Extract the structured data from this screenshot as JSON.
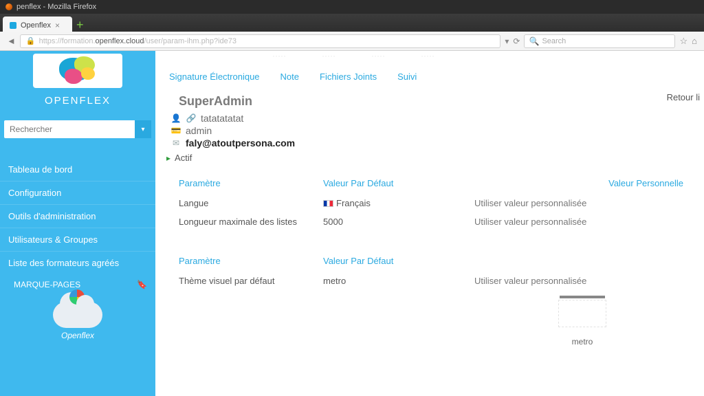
{
  "browser": {
    "window_title": "penflex - Mozilla Firefox",
    "tab_title": "Openflex",
    "url_faded_prefix": "https://formation.",
    "url_host": "openflex.cloud",
    "url_faded_suffix": "/user/param-ihm.php?ide73",
    "search_placeholder": "Search"
  },
  "sidebar": {
    "brand": "OPENFLEX",
    "search_placeholder": "Rechercher",
    "items": [
      "Tableau de bord",
      "Configuration",
      "Outils d'administration",
      "Utilisateurs & Groupes",
      "Liste des formateurs agréés"
    ],
    "bookmarks_label": "MARQUE-PAGES",
    "widget_name": "Openflex"
  },
  "subtabs": {
    "signature": "Signature Électronique",
    "note": "Note",
    "files": "Fichiers Joints",
    "tracking": "Suivi"
  },
  "back_link": "Retour li",
  "user": {
    "title": "SuperAdmin",
    "name_label": "tatatatatat",
    "login": "admin",
    "email": "faly@atoutpersona.com",
    "status": "Actif"
  },
  "params_section1": {
    "header_param": "Paramètre",
    "header_default": "Valeur Par Défaut",
    "header_personal": "Valeur Personnelle",
    "rows": [
      {
        "param": "Langue",
        "default": "Français",
        "personal": "Utiliser valeur personnalisée"
      },
      {
        "param": "Longueur maximale des listes",
        "default": "5000",
        "personal": "Utiliser valeur personnalisée"
      }
    ]
  },
  "params_section2": {
    "header_param": "Paramètre",
    "header_default": "Valeur Par Défaut",
    "row": {
      "param": "Thème visuel par défaut",
      "default": "metro",
      "personal": "Utiliser valeur personnalisée"
    },
    "preview_name": "metro"
  }
}
